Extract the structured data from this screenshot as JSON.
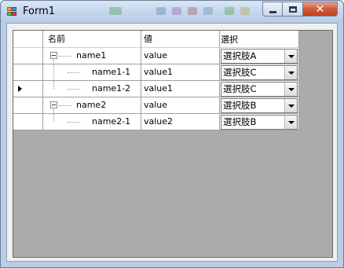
{
  "window": {
    "title": "Form1"
  },
  "grid": {
    "columns": [
      {
        "key": "name",
        "header": "名前"
      },
      {
        "key": "value",
        "header": "値"
      },
      {
        "key": "select",
        "header": "選択"
      }
    ],
    "rows": [
      {
        "name": "name1",
        "level": 0,
        "expander": "collapse",
        "value": "value",
        "select": "選択肢A",
        "current": false
      },
      {
        "name": "name1-1",
        "level": 1,
        "expander": "",
        "value": "value1",
        "select": "選択肢C",
        "current": false
      },
      {
        "name": "name1-2",
        "level": 1,
        "expander": "",
        "value": "value1",
        "select": "選択肢C",
        "current": true
      },
      {
        "name": "name2",
        "level": 0,
        "expander": "collapse",
        "value": "value",
        "select": "選択肢B",
        "current": false
      },
      {
        "name": "name2-1",
        "level": 1,
        "expander": "",
        "value": "value2",
        "select": "選択肢B",
        "current": false
      }
    ]
  },
  "icons": {
    "app": "form-app-icon",
    "minimize": "minimize-icon",
    "maximize": "maximize-icon",
    "close": "close-icon",
    "combo_arrow": "dropdown-arrow-icon",
    "current_row": "current-row-arrow-icon",
    "expander": "tree-collapse-icon"
  },
  "colors": {
    "grid_background": "#ababab",
    "close_button": "#c1401f"
  }
}
